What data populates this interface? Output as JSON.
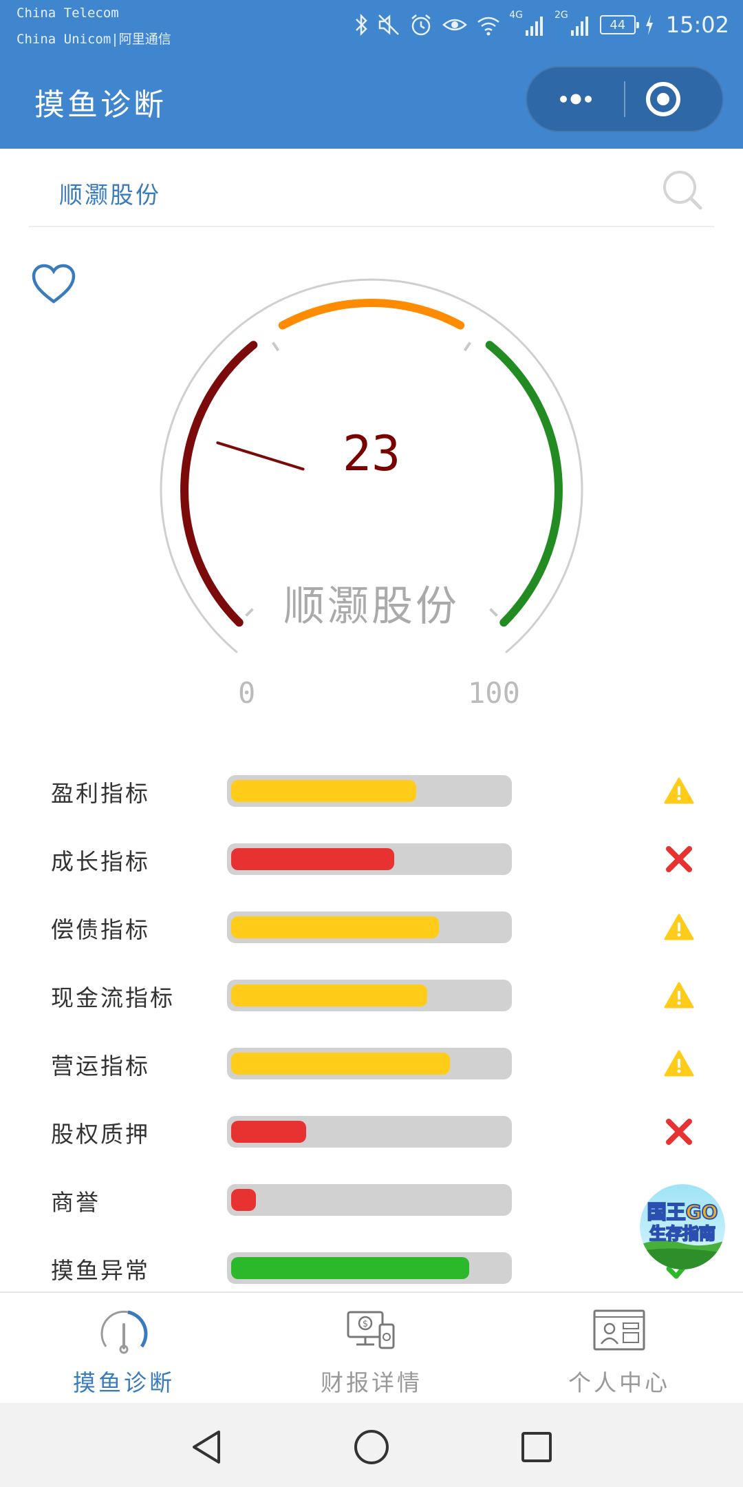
{
  "status_bar": {
    "carrier_1": "China  Telecom",
    "carrier_2": "China  Unicom|阿里通信",
    "battery": "44",
    "time": "15:02",
    "net_1": "4G",
    "net_2": "2G"
  },
  "app": {
    "title": "摸鱼诊断"
  },
  "search": {
    "value": "顺灏股份"
  },
  "gauge": {
    "value": 23,
    "value_text": "23",
    "stock_name": "顺灏股份",
    "min_label": "0",
    "max_label": "100",
    "min": 0,
    "max": 100,
    "colors": {
      "low": "#7B0A0A",
      "mid": "#FF8C00",
      "high": "#228B22",
      "needle": "#7B0A0A"
    }
  },
  "indicators": [
    {
      "label": "盈利指标",
      "level": 0.67,
      "color": "#FFCC19",
      "status": "warning"
    },
    {
      "label": "成长指标",
      "level": 0.59,
      "color": "#E83232",
      "status": "fail"
    },
    {
      "label": "偿债指标",
      "level": 0.75,
      "color": "#FFCC19",
      "status": "warning"
    },
    {
      "label": "现金流指标",
      "level": 0.71,
      "color": "#FFCC19",
      "status": "warning"
    },
    {
      "label": "营运指标",
      "level": 0.79,
      "color": "#FFCC19",
      "status": "warning"
    },
    {
      "label": "股权质押",
      "level": 0.27,
      "color": "#E83232",
      "status": "fail"
    },
    {
      "label": "商誉",
      "level": 0.09,
      "color": "#E83232",
      "status": "none"
    },
    {
      "label": "摸鱼异常",
      "level": 0.86,
      "color": "#2BB82B",
      "status": "pass"
    }
  ],
  "badge": {
    "text": "国王GO 生存指南"
  },
  "tabs": [
    {
      "label": "摸鱼诊断",
      "icon": "gauge-icon",
      "active": true
    },
    {
      "label": "财报详情",
      "icon": "report-icon",
      "active": false
    },
    {
      "label": "个人中心",
      "icon": "profile-icon",
      "active": false
    }
  ],
  "colors": {
    "brand": "#3F86CF",
    "active_tab": "#3A7BBD",
    "inactive_tab": "#999999"
  }
}
